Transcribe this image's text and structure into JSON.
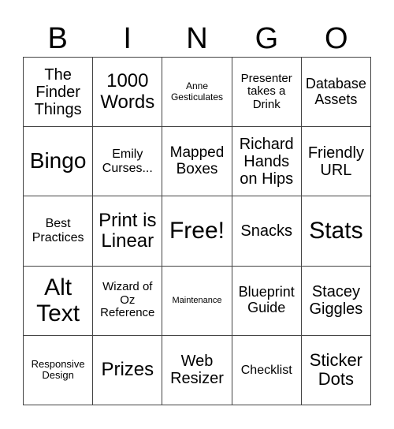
{
  "header": [
    "B",
    "I",
    "N",
    "G",
    "O"
  ],
  "cells": [
    [
      "The Finder Things",
      "1000 Words",
      "Anne Gesticulates",
      "Presenter takes a Drink",
      "Database Assets"
    ],
    [
      "Bingo",
      "Emily Curses...",
      "Mapped Boxes",
      "Richard Hands on Hips",
      "Friendly URL"
    ],
    [
      "Best Practices",
      "Print is Linear",
      "Free!",
      "Snacks",
      "Stats"
    ],
    [
      "Alt Text",
      "Wizard of Oz Reference",
      "Maintenance",
      "Blueprint Guide",
      "Stacey Giggles"
    ],
    [
      "Responsive Design",
      "Prizes",
      "Web Resizer",
      "Checklist",
      "Sticker Dots"
    ]
  ]
}
